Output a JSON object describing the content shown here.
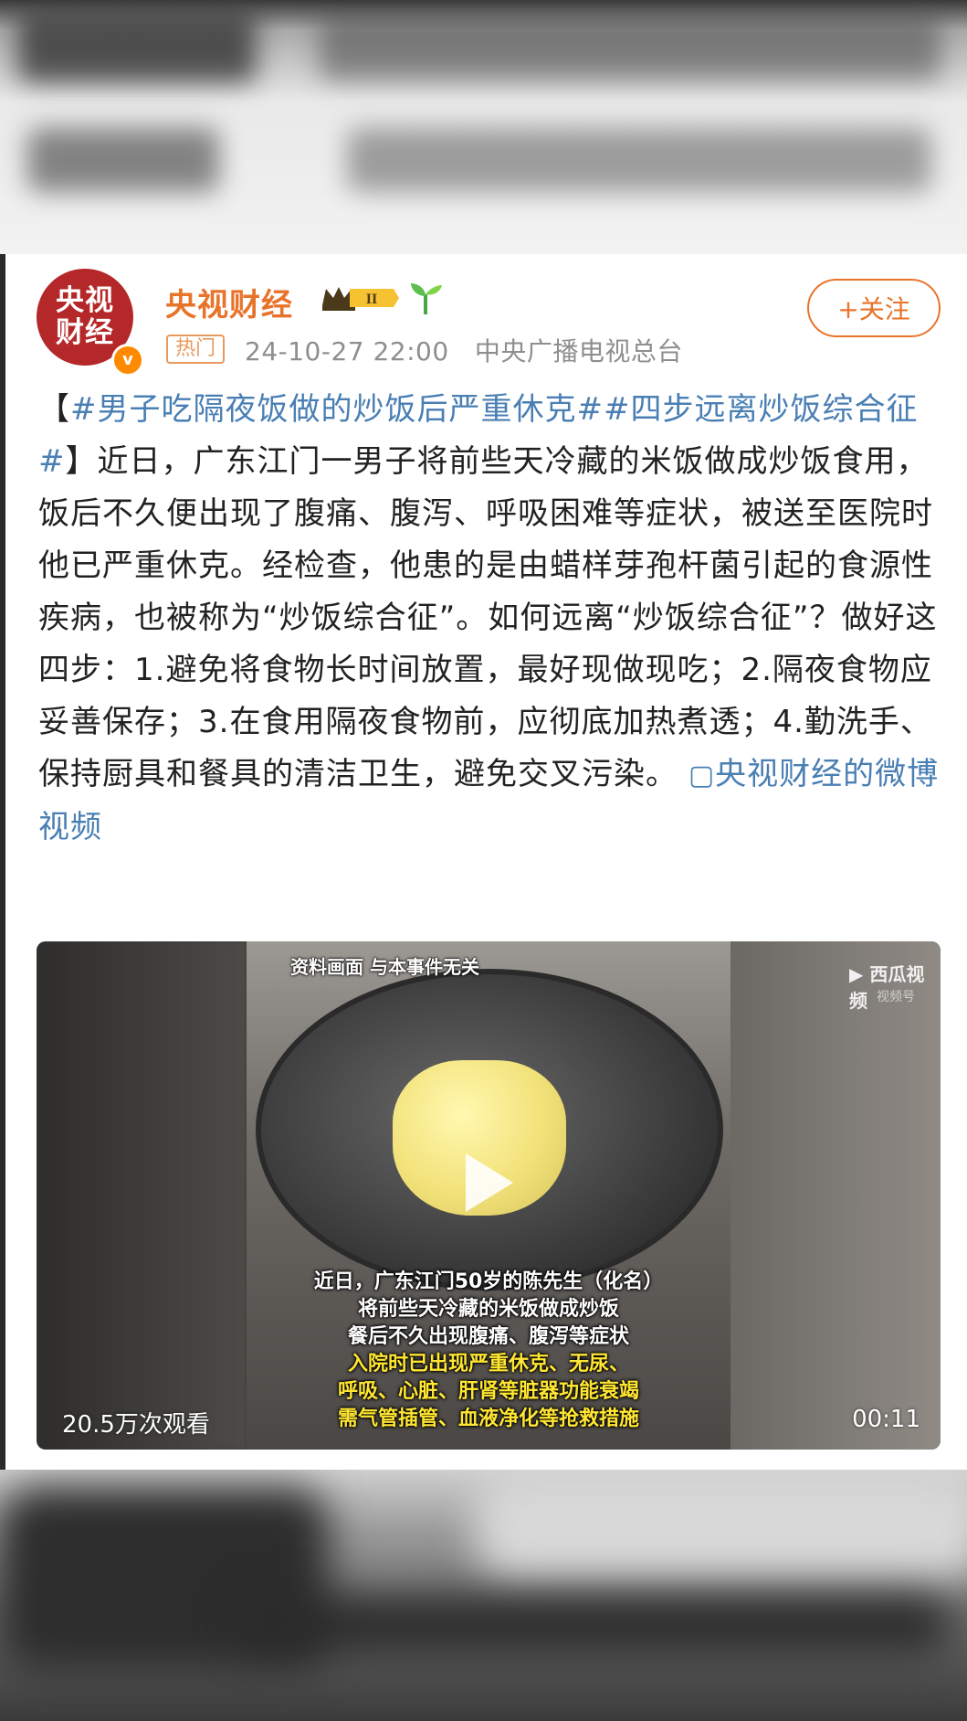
{
  "post": {
    "avatar_text_1": "央视",
    "avatar_text_2": "财经",
    "verified_mark": "v",
    "username": "央视财经",
    "level_badge": "II",
    "hot_tag": "热门",
    "timestamp": "24-10-27 22:00",
    "source": "中央广播电视总台",
    "follow_label": "+关注",
    "body": {
      "open_bracket": "【",
      "hashtag_1": "#男子吃隔夜饭做的炒饭后严重休克#",
      "hashtag_2": "#四步远离炒饭综合征#",
      "close_bracket": "】",
      "text": "近日，广东江门一男子将前些天冷藏的米饭做成炒饭食用，饭后不久便出现了腹痛、腹泻、呼吸困难等症状，被送至医院时他已严重休克。经检查，他患的是由蜡样芽孢杆菌引起的食源性疾病，也被称为“炒饭综合征”。如何远离“炒饭综合征”？做好这四步：1.避免将食物长时间放置，最好现做现吃；2.隔夜食物应妥善保存；3.在食用隔夜食物前，应彻底加热煮透；4.勤洗手、保持厨具和餐具的清洁卫生，避免交叉污染。",
      "video_link": "央视财经的微博视频"
    }
  },
  "video": {
    "overlay_top": "资料画面 与本事件无关",
    "watermark": "西瓜视频",
    "watermark_sub": "视频号",
    "caption_lines": [
      "近日，广东江门50岁的陈先生（化名）",
      "将前些天冷藏的米饭做成炒饭",
      "餐后不久出现腹痛、腹泻等症状",
      "入院时已出现严重休克、无尿、",
      "呼吸、心脏、肝肾等脏器功能衰竭",
      "需气管插管、血液净化等抢救措施"
    ],
    "views": "20.5万次观看",
    "duration": "00:11"
  },
  "colors": {
    "accent_orange": "#e8732a",
    "link_blue": "#4a7fb4",
    "avatar_red": "#b5282a"
  }
}
